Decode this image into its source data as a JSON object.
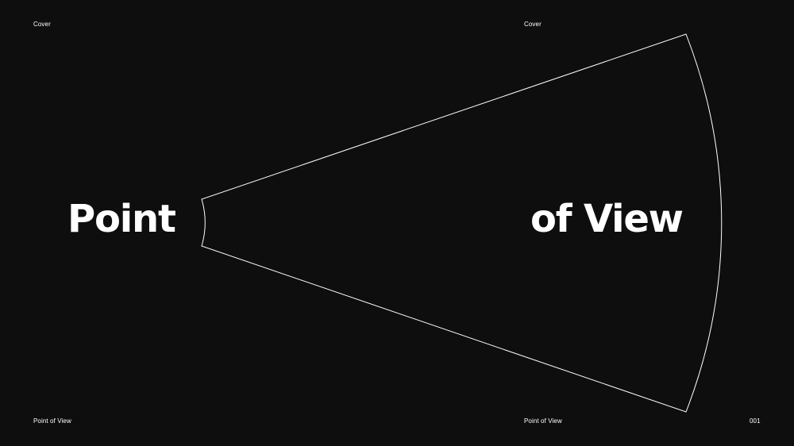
{
  "header": {
    "left_label": "Cover",
    "mid_label": "Cover"
  },
  "title": {
    "left": "Point",
    "right": "of View"
  },
  "footer": {
    "left_label": "Point of View",
    "mid_label": "Point of View",
    "page_number": "001"
  },
  "colors": {
    "background": "#0e0e0e",
    "text": "#ffffff",
    "outline": "#ffffff"
  },
  "graphic": {
    "shape": "fan-sector-outline"
  }
}
